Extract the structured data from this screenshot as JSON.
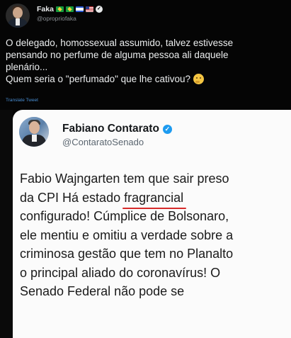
{
  "outer_tweet": {
    "display_name": "Faka",
    "handle": "@opropriofaka",
    "flag_icons": [
      "brazil-flag-icon",
      "brazil-flag-icon",
      "israel-flag-icon",
      "usa-flag-icon"
    ],
    "text_lines": [
      "O delegado, homossexual assumido, talvez estivesse",
      "pensando no perfume de alguma pessoa ali daquele",
      "plenário...",
      "Quem seria o \"perfumado\" que lhe cativou?"
    ],
    "emoji": "thinking-face-icon",
    "translate_label": "Translate Tweet"
  },
  "quoted_tweet": {
    "display_name": "Fabiano Contarato",
    "handle": "@ContaratoSenado",
    "text_line_1": "Fabio Wajngarten tem que sair preso",
    "text_line_2_before": "da CPI Há estado ",
    "text_line_2_underlined": "fragrancial",
    "text_lines_rest": [
      "configurado! Cúmplice de Bolsonaro,",
      "ele mentiu e omitiu a verdade sobre a",
      "criminosa gestão que tem no Planalto",
      "o principal aliado do coronavírus! O",
      "Senado Federal não pode se"
    ]
  },
  "colors": {
    "outer_background": "#050505",
    "card_background": "#fbfbfb",
    "verified_blue": "#1d9bf0",
    "link_blue": "#4a8fd4",
    "underline_red": "#d62a2a"
  }
}
